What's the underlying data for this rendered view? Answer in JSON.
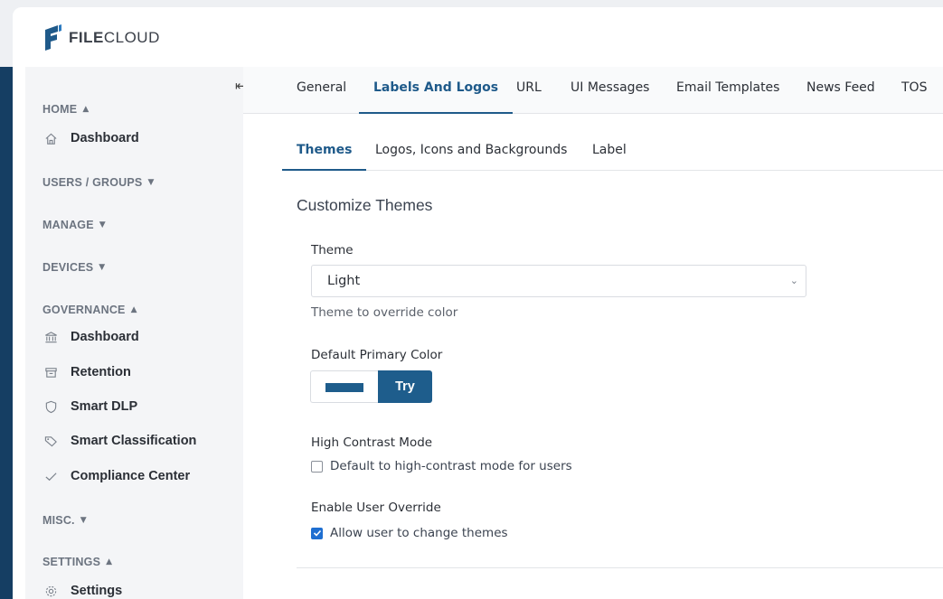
{
  "app": {
    "logo_text_bold": "FILE",
    "logo_text": "CLOUD"
  },
  "colors": {
    "brand": "#1f5a8a",
    "sidebar_strip": "#153e63",
    "primary_swatch": "#1e5d8c",
    "try_button": "#1e5d8c"
  },
  "sidebar": {
    "collapse_icon": "collapse-left-icon",
    "sections": [
      {
        "label": "HOME",
        "caret": "▲",
        "items": [
          {
            "label": "Dashboard",
            "icon": "home-icon"
          }
        ]
      },
      {
        "label": "USERS / GROUPS",
        "caret": "▼",
        "items": []
      },
      {
        "label": "MANAGE",
        "caret": "▼",
        "items": []
      },
      {
        "label": "DEVICES",
        "caret": "▼",
        "items": []
      },
      {
        "label": "GOVERNANCE",
        "caret": "▲",
        "items": [
          {
            "label": "Dashboard",
            "icon": "bank-icon"
          },
          {
            "label": "Retention",
            "icon": "archive-icon"
          },
          {
            "label": "Smart DLP",
            "icon": "shield-icon"
          },
          {
            "label": "Smart Classification",
            "icon": "tags-icon"
          },
          {
            "label": "Compliance Center",
            "icon": "check-icon"
          }
        ]
      },
      {
        "label": "MISC.",
        "caret": "▼",
        "items": []
      },
      {
        "label": "SETTINGS",
        "caret": "▲",
        "items": [
          {
            "label": "Settings",
            "icon": "gear-icon"
          }
        ]
      }
    ]
  },
  "tabs": [
    "General",
    "Labels And Logos",
    "URL",
    "UI Messages",
    "Email Templates",
    "News Feed",
    "TOS"
  ],
  "active_tab": "Labels And Logos",
  "subtabs": [
    "Themes",
    "Logos, Icons and Backgrounds",
    "Label"
  ],
  "active_subtab": "Themes",
  "content": {
    "title": "Customize Themes",
    "theme_label": "Theme",
    "theme_value": "Light",
    "theme_help": "Theme to override color",
    "primary_color_label": "Default Primary Color",
    "try_label": "Try",
    "high_contrast_label": "High Contrast Mode",
    "high_contrast_checkbox": "Default to high-contrast mode for users",
    "high_contrast_checked": false,
    "override_label": "Enable User Override",
    "override_checkbox": "Allow user to change themes",
    "override_checked": true
  }
}
